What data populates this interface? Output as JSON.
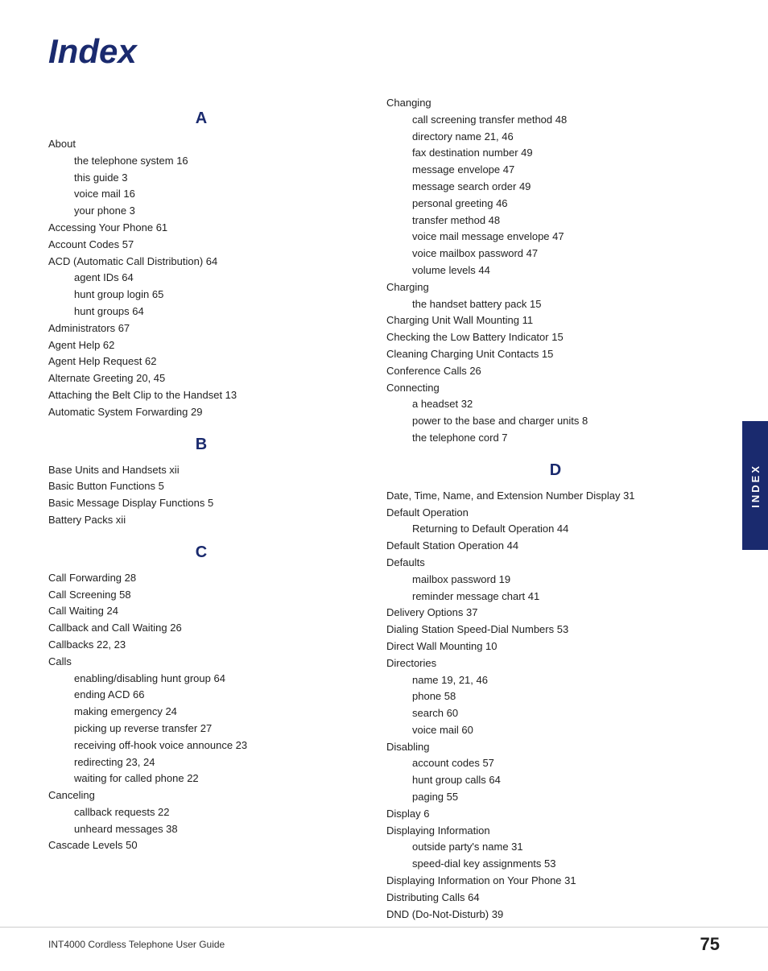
{
  "title": "Index",
  "footer": {
    "left": "INT4000 Cordless Telephone User Guide",
    "right": "75"
  },
  "side_tab": "INDEX",
  "sections": {
    "A": {
      "letter": "A",
      "entries": [
        {
          "text": "About",
          "pg": ""
        },
        {
          "text": "the telephone system   16",
          "indent": 1
        },
        {
          "text": "this guide   3",
          "indent": 1
        },
        {
          "text": "voice mail   16",
          "indent": 1
        },
        {
          "text": "your phone   3",
          "indent": 1
        },
        {
          "text": "Accessing Your Phone   61",
          "indent": 0
        },
        {
          "text": "Account Codes   57",
          "indent": 0
        },
        {
          "text": "ACD (Automatic Call Distribution)   64",
          "indent": 0
        },
        {
          "text": "agent IDs   64",
          "indent": 1
        },
        {
          "text": "hunt group login   65",
          "indent": 1
        },
        {
          "text": "hunt groups   64",
          "indent": 1
        },
        {
          "text": "Administrators   67",
          "indent": 0
        },
        {
          "text": "Agent Help   62",
          "indent": 0
        },
        {
          "text": "Agent Help Request   62",
          "indent": 0
        },
        {
          "text": "Alternate Greeting   20,  45",
          "indent": 0
        },
        {
          "text": "Attaching the Belt Clip to the Handset   13",
          "indent": 0
        },
        {
          "text": "Automatic System Forwarding   29",
          "indent": 0
        }
      ]
    },
    "B": {
      "letter": "B",
      "entries": [
        {
          "text": "Base Units and Handsets   xii",
          "indent": 0
        },
        {
          "text": "Basic Button Functions   5",
          "indent": 0
        },
        {
          "text": "Basic Message Display Functions   5",
          "indent": 0
        },
        {
          "text": "Battery Packs   xii",
          "indent": 0
        }
      ]
    },
    "C": {
      "letter": "C",
      "entries": [
        {
          "text": "Call Forwarding   28",
          "indent": 0
        },
        {
          "text": "Call Screening   58",
          "indent": 0
        },
        {
          "text": "Call Waiting   24",
          "indent": 0
        },
        {
          "text": "Callback and Call Waiting   26",
          "indent": 0
        },
        {
          "text": "Callbacks   22,  23",
          "indent": 0
        },
        {
          "text": "Calls",
          "indent": 0
        },
        {
          "text": "enabling/disabling hunt group   64",
          "indent": 1
        },
        {
          "text": "ending ACD   66",
          "indent": 1
        },
        {
          "text": "making emergency   24",
          "indent": 1
        },
        {
          "text": "picking up reverse transfer   27",
          "indent": 1
        },
        {
          "text": "receiving off-hook voice announce   23",
          "indent": 1
        },
        {
          "text": "redirecting   23,  24",
          "indent": 1
        },
        {
          "text": "waiting for called phone   22",
          "indent": 1
        },
        {
          "text": "Canceling",
          "indent": 0
        },
        {
          "text": "callback requests   22",
          "indent": 1
        },
        {
          "text": "unheard messages   38",
          "indent": 1
        },
        {
          "text": "Cascade Levels   50",
          "indent": 0
        }
      ]
    },
    "C_right": {
      "letter": "",
      "entries": [
        {
          "text": "Changing",
          "indent": 0
        },
        {
          "text": "call screening transfer method   48",
          "indent": 1
        },
        {
          "text": "directory name   21,  46",
          "indent": 1
        },
        {
          "text": "fax destination number   49",
          "indent": 1
        },
        {
          "text": "message envelope   47",
          "indent": 1
        },
        {
          "text": "message search order   49",
          "indent": 1
        },
        {
          "text": "personal greeting   46",
          "indent": 1
        },
        {
          "text": "transfer method   48",
          "indent": 1
        },
        {
          "text": "voice mail message envelope   47",
          "indent": 1
        },
        {
          "text": "voice mailbox password   47",
          "indent": 1
        },
        {
          "text": "volume levels   44",
          "indent": 1
        },
        {
          "text": "Charging",
          "indent": 0
        },
        {
          "text": "the handset battery pack   15",
          "indent": 1
        },
        {
          "text": "Charging Unit Wall Mounting   11",
          "indent": 0
        },
        {
          "text": "Checking the Low Battery Indicator   15",
          "indent": 0
        },
        {
          "text": "Cleaning Charging Unit Contacts   15",
          "indent": 0
        },
        {
          "text": "Conference Calls   26",
          "indent": 0
        },
        {
          "text": "Connecting",
          "indent": 0
        },
        {
          "text": "a headset   32",
          "indent": 1
        },
        {
          "text": "power to the base and charger units   8",
          "indent": 1
        },
        {
          "text": "the telephone cord   7",
          "indent": 1
        }
      ]
    },
    "D": {
      "letter": "D",
      "entries": [
        {
          "text": "Date, Time, Name, and Extension Number Display   31",
          "indent": 0
        },
        {
          "text": "Default Operation",
          "indent": 0
        },
        {
          "text": "Returning to Default Operation   44",
          "indent": 1
        },
        {
          "text": "Default Station Operation   44",
          "indent": 0
        },
        {
          "text": "Defaults",
          "indent": 0
        },
        {
          "text": "mailbox password   19",
          "indent": 1
        },
        {
          "text": "reminder message chart   41",
          "indent": 1
        },
        {
          "text": "Delivery Options   37",
          "indent": 0
        },
        {
          "text": "Dialing Station Speed-Dial Numbers   53",
          "indent": 0
        },
        {
          "text": "Direct Wall Mounting   10",
          "indent": 0
        },
        {
          "text": "Directories",
          "indent": 0
        },
        {
          "text": "name   19,  21,  46",
          "indent": 1
        },
        {
          "text": "phone   58",
          "indent": 1
        },
        {
          "text": "search   60",
          "indent": 1
        },
        {
          "text": "voice mail   60",
          "indent": 1
        },
        {
          "text": "Disabling",
          "indent": 0
        },
        {
          "text": "account codes   57",
          "indent": 1
        },
        {
          "text": "hunt group calls   64",
          "indent": 1
        },
        {
          "text": "paging   55",
          "indent": 1
        },
        {
          "text": "Display   6",
          "indent": 0
        },
        {
          "text": "Displaying Information",
          "indent": 0
        },
        {
          "text": "outside party's name   31",
          "indent": 1
        },
        {
          "text": "speed-dial key assignments   53",
          "indent": 1
        },
        {
          "text": "Displaying Information on Your Phone   31",
          "indent": 0
        },
        {
          "text": "Distributing Calls   64",
          "indent": 0
        },
        {
          "text": "DND (Do-Not-Disturb)   39",
          "indent": 0
        }
      ]
    }
  }
}
